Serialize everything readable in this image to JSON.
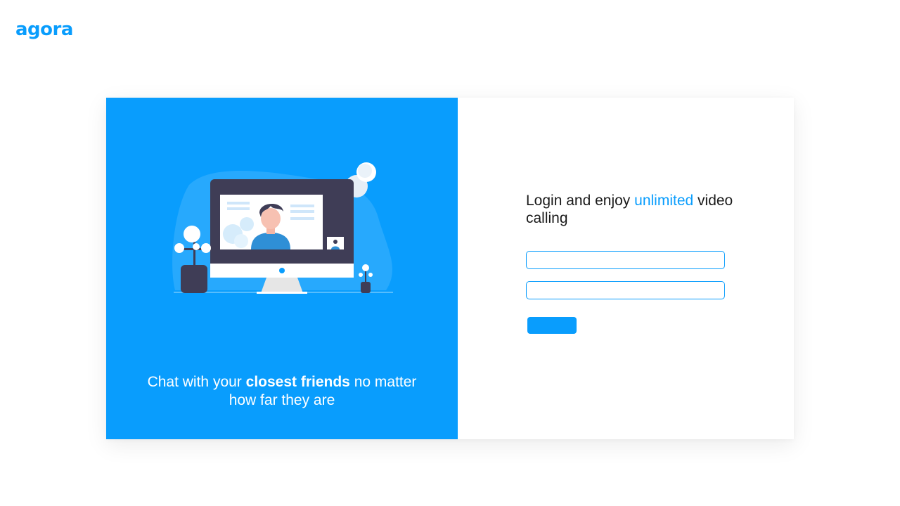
{
  "brand": {
    "logo_text": "agora",
    "color": "#099dfd"
  },
  "hero": {
    "tagline_pre": "Chat with your ",
    "tagline_bold": "closest friends",
    "tagline_post": " no matter how far they are",
    "background": "#099dfd",
    "illustration_icon": "video-call-monitor-illustration"
  },
  "login": {
    "heading_pre": "Login and enjoy ",
    "heading_accent": "unlimited",
    "heading_post": " video calling",
    "fields": [
      {
        "value": "",
        "placeholder": ""
      },
      {
        "value": "",
        "placeholder": ""
      }
    ],
    "submit_label": ""
  }
}
